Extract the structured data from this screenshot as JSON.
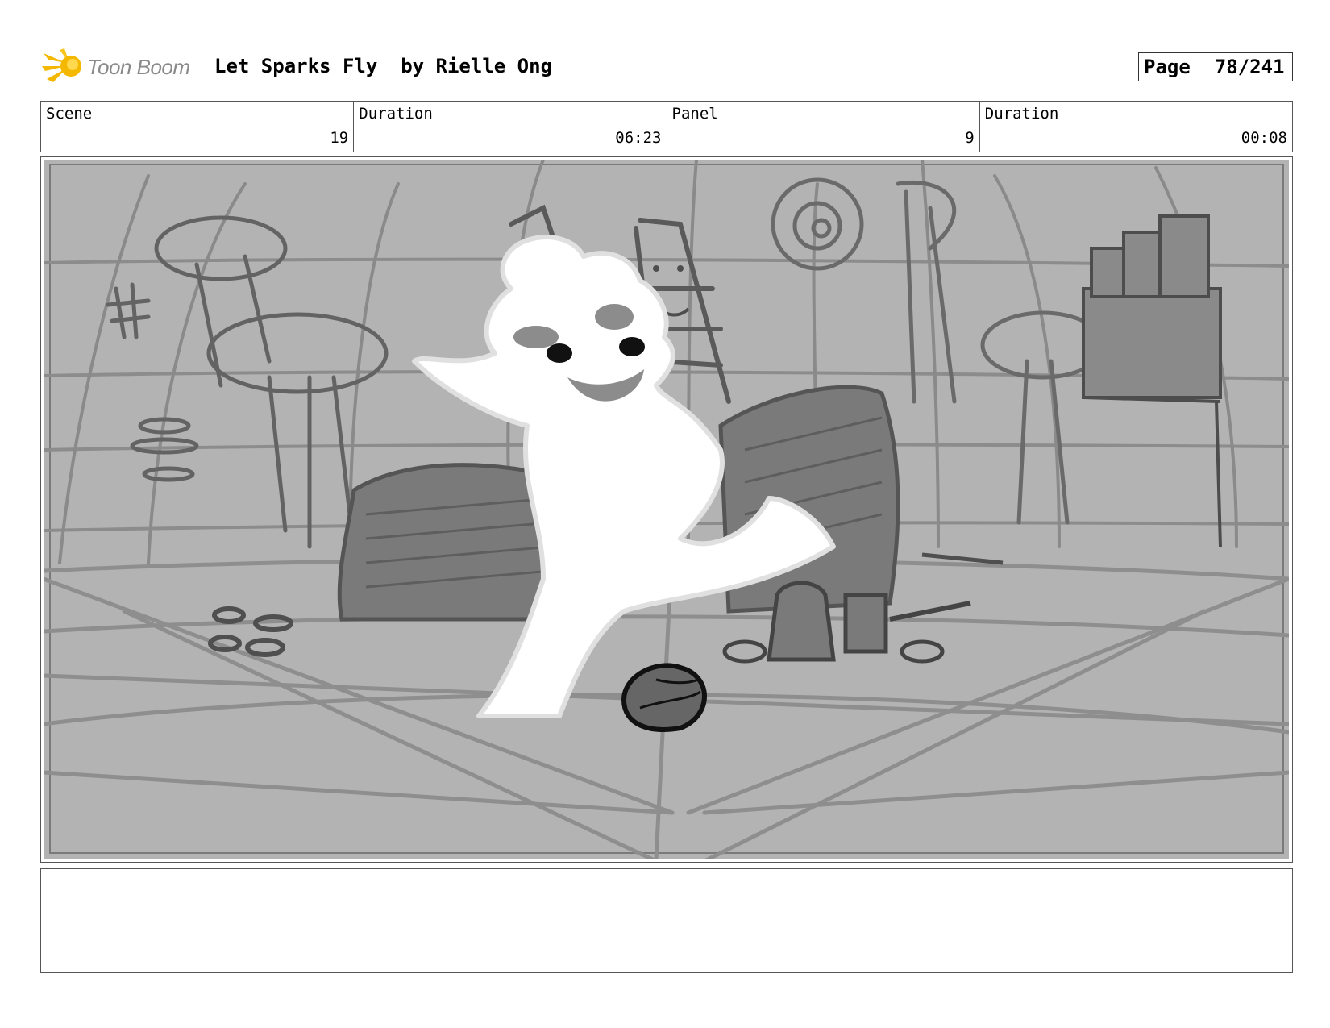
{
  "header": {
    "logo_text": "Toon Boom",
    "project_title": "Let Sparks Fly  by Rielle Ong",
    "page_label": "Page",
    "page_number": "78/241"
  },
  "info": {
    "scene_label": "Scene",
    "scene_value": "19",
    "scene_duration_label": "Duration",
    "scene_duration_value": "06:23",
    "panel_label": "Panel",
    "panel_value": "9",
    "panel_duration_label": "Duration",
    "panel_duration_value": "00:08"
  },
  "colors": {
    "logo_yellow": "#f5b800",
    "sketch_bg": "#b3b3b3",
    "sketch_line": "#6e6e6e",
    "character": "#ffffff"
  },
  "notes": {
    "text": ""
  }
}
